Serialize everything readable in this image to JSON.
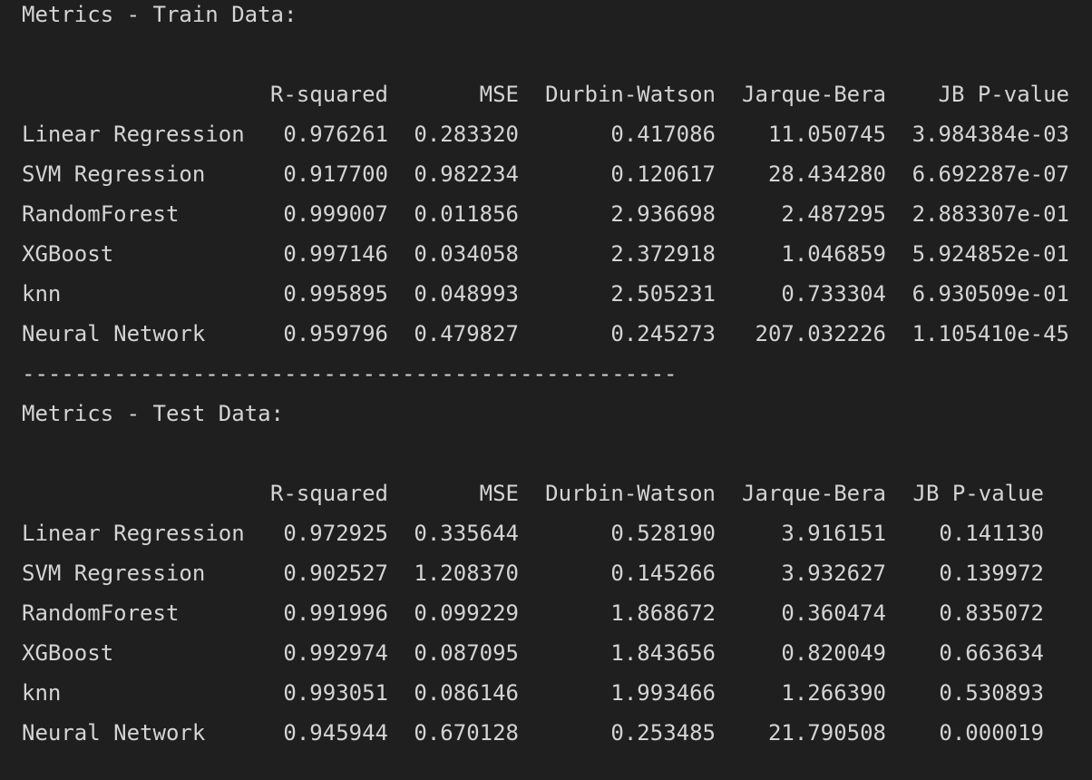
{
  "train": {
    "title": "Metrics - Train Data:",
    "headers": [
      "R-squared",
      "MSE",
      "Durbin-Watson",
      "Jarque-Bera",
      "JB P-value"
    ],
    "rows": [
      {
        "name": "Linear Regression",
        "r2": "0.976261",
        "mse": "0.283320",
        "dw": "0.417086",
        "jb": "11.050745",
        "p": "3.984384e-03"
      },
      {
        "name": "SVM Regression",
        "r2": "0.917700",
        "mse": "0.982234",
        "dw": "0.120617",
        "jb": "28.434280",
        "p": "6.692287e-07"
      },
      {
        "name": "RandomForest",
        "r2": "0.999007",
        "mse": "0.011856",
        "dw": "2.936698",
        "jb": "2.487295",
        "p": "2.883307e-01"
      },
      {
        "name": "XGBoost",
        "r2": "0.997146",
        "mse": "0.034058",
        "dw": "2.372918",
        "jb": "1.046859",
        "p": "5.924852e-01"
      },
      {
        "name": "knn",
        "r2": "0.995895",
        "mse": "0.048993",
        "dw": "2.505231",
        "jb": "0.733304",
        "p": "6.930509e-01"
      },
      {
        "name": "Neural Network",
        "r2": "0.959796",
        "mse": "0.479827",
        "dw": "0.245273",
        "jb": "207.032226",
        "p": "1.105410e-45"
      }
    ]
  },
  "separator": "--------------------------------------------------",
  "test": {
    "title": "Metrics - Test Data:",
    "headers": [
      "R-squared",
      "MSE",
      "Durbin-Watson",
      "Jarque-Bera",
      "JB P-value"
    ],
    "rows": [
      {
        "name": "Linear Regression",
        "r2": "0.972925",
        "mse": "0.335644",
        "dw": "0.528190",
        "jb": "3.916151",
        "p": "0.141130"
      },
      {
        "name": "SVM Regression",
        "r2": "0.902527",
        "mse": "1.208370",
        "dw": "0.145266",
        "jb": "3.932627",
        "p": "0.139972"
      },
      {
        "name": "RandomForest",
        "r2": "0.991996",
        "mse": "0.099229",
        "dw": "1.868672",
        "jb": "0.360474",
        "p": "0.835072"
      },
      {
        "name": "XGBoost",
        "r2": "0.992974",
        "mse": "0.087095",
        "dw": "1.843656",
        "jb": "0.820049",
        "p": "0.663634"
      },
      {
        "name": "knn",
        "r2": "0.993051",
        "mse": "0.086146",
        "dw": "1.993466",
        "jb": "1.266390",
        "p": "0.530893"
      },
      {
        "name": "Neural Network",
        "r2": "0.945944",
        "mse": "0.670128",
        "dw": "0.253485",
        "jb": "21.790508",
        "p": "0.000019"
      }
    ]
  },
  "colors": {
    "background": "#1f1f1f",
    "text": "#d4d4d4"
  }
}
